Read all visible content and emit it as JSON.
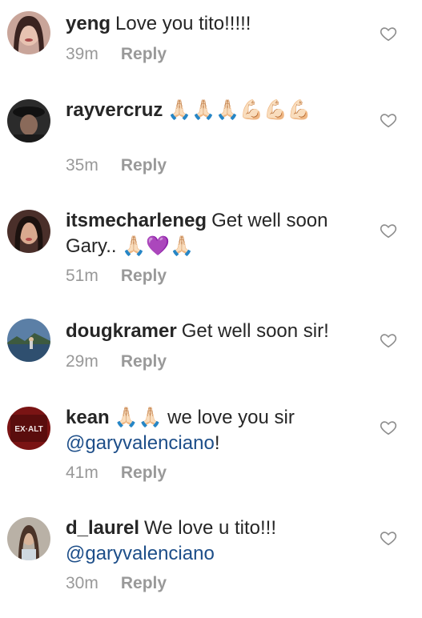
{
  "comments": [
    {
      "username": "yeng",
      "text": "Love you tito!!!!!",
      "time": "39m",
      "reply_label": "Reply"
    },
    {
      "username": "rayvercruz",
      "emojis": "🙏🏻🙏🏻🙏🏻💪🏻💪🏻💪🏻",
      "time": "35m",
      "reply_label": "Reply"
    },
    {
      "username": "itsmecharleneg",
      "text": "Get well soon Gary..",
      "emojis": "🙏🏻💜🙏🏻",
      "time": "51m",
      "reply_label": "Reply"
    },
    {
      "username": "dougkramer",
      "text": "Get well soon sir!",
      "time": "29m",
      "reply_label": "Reply"
    },
    {
      "username": "kean",
      "emojis": "🙏🏻🙏🏻",
      "text": "we love you sir",
      "mention": "@garyvalenciano",
      "suffix": "!",
      "avatar_text": "EX·ALT",
      "time": "41m",
      "reply_label": "Reply"
    },
    {
      "username": "d_laurel",
      "text": "We love u tito!!!",
      "mention": "@garyvalenciano",
      "time": "30m",
      "reply_label": "Reply"
    }
  ],
  "colors": {
    "username": "#262626",
    "text": "#262626",
    "mention": "#1d4e89",
    "meta": "#999999",
    "heart_outline": "#8e8e8e"
  },
  "icons": {
    "like": "heart-outline-icon"
  }
}
